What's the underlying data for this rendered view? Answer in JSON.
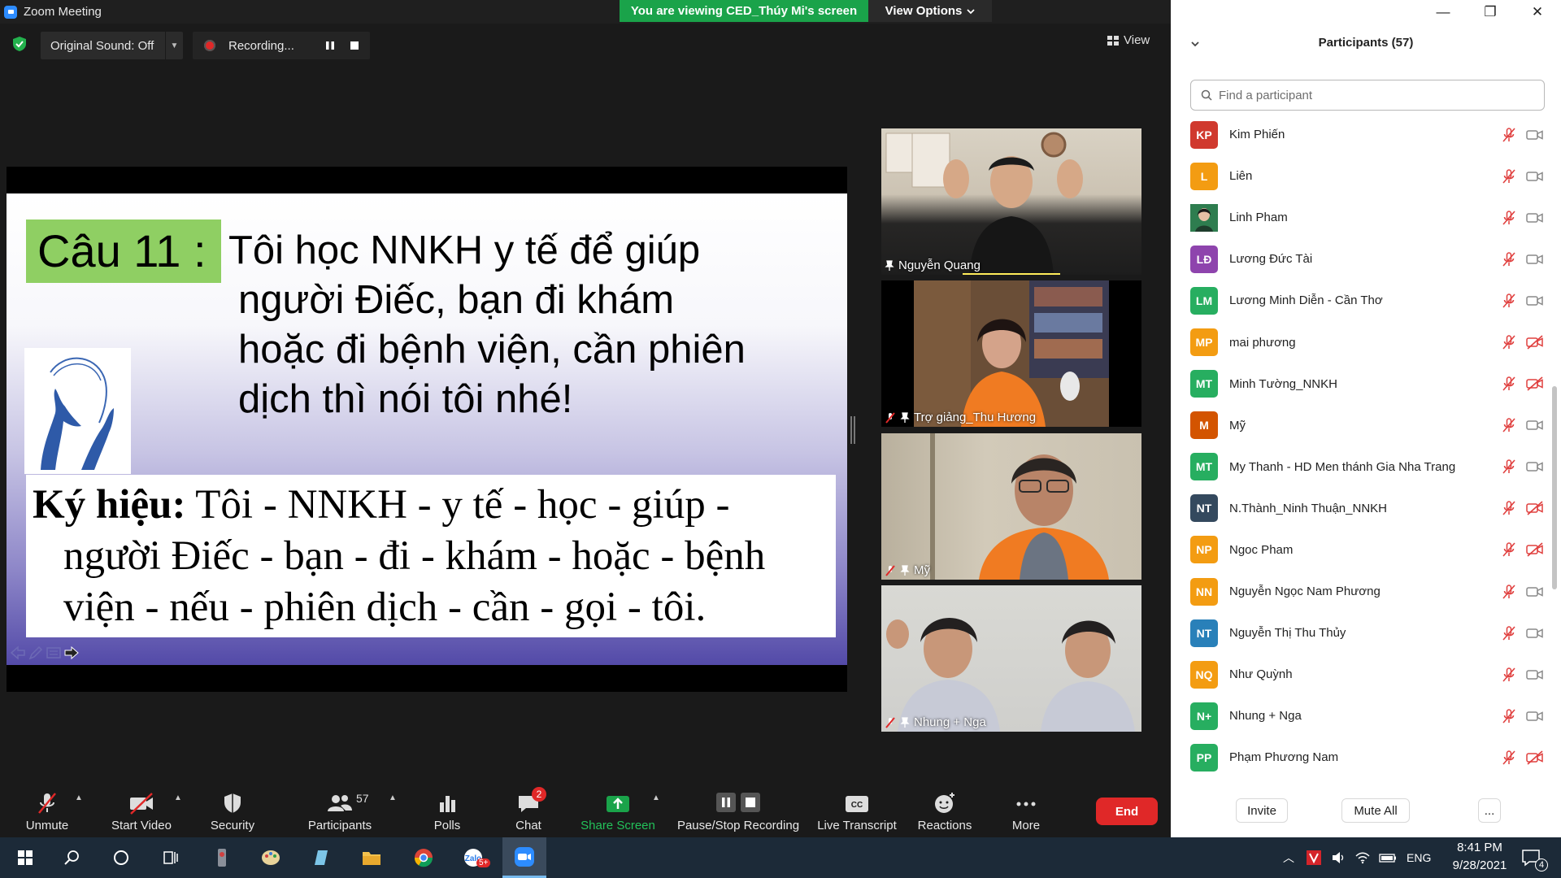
{
  "window": {
    "title": "Zoom Meeting",
    "viewing_banner": "You are viewing CED_Thúy Mi's screen",
    "view_options": "View Options",
    "minimize": "—",
    "maximize": "❐",
    "close": "✕"
  },
  "top_toolbar": {
    "sound_label": "Original Sound: Off",
    "recording_label": "Recording...",
    "view_label": "View"
  },
  "slide": {
    "question_label": "Câu 11 :",
    "question_lines": [
      "Tôi học NNKH y tế để giúp",
      "người Điếc, bạn đi khám",
      "hoặc đi bệnh viện, cần phiên",
      "dịch thì nói tôi nhé!"
    ],
    "sign_label": "Ký hiệu:",
    "sign_lines": [
      "Tôi - NNKH - y tế - học - giúp -",
      "người Điếc - bạn - đi - khám - hoặc - bệnh",
      "viện - nếu - phiên dịch - cần - gọi - tôi."
    ]
  },
  "videos": [
    {
      "name": "Nguyễn Quang",
      "muted": false
    },
    {
      "name": "Trợ giảng_Thu Hương",
      "muted": true
    },
    {
      "name": "Mỹ",
      "muted": true
    },
    {
      "name": "Nhung + Nga",
      "muted": true
    }
  ],
  "participants_panel": {
    "title": "Participants (57)",
    "search_placeholder": "Find a participant",
    "items": [
      {
        "initials": "KP",
        "name": "Kim Phiến",
        "color": "#d0392e",
        "video_off": false
      },
      {
        "initials": "L",
        "name": "Liên",
        "color": "#f39c12",
        "video_off": false
      },
      {
        "initials": "",
        "name": "Linh Pham",
        "color": "#2e7d4f",
        "video_off": false,
        "photo": true
      },
      {
        "initials": "LĐ",
        "name": "Lương Đức Tài",
        "color": "#8e44ad",
        "video_off": false
      },
      {
        "initials": "LM",
        "name": "Lương Minh Diễn - Cần Thơ",
        "color": "#27ae60",
        "video_off": false
      },
      {
        "initials": "MP",
        "name": "mai phương",
        "color": "#f39c12",
        "video_off": true
      },
      {
        "initials": "MT",
        "name": "Minh Tường_NNKH",
        "color": "#27ae60",
        "video_off": true
      },
      {
        "initials": "M",
        "name": "Mỹ",
        "color": "#d35400",
        "video_off": false
      },
      {
        "initials": "MT",
        "name": "My Thanh - HD Men thánh Gia Nha Trang",
        "color": "#27ae60",
        "video_off": false
      },
      {
        "initials": "NT",
        "name": "N.Thành_Ninh Thuận_NNKH",
        "color": "#34495e",
        "video_off": true
      },
      {
        "initials": "NP",
        "name": "Ngoc Pham",
        "color": "#f39c12",
        "video_off": true
      },
      {
        "initials": "NN",
        "name": "Nguyễn Ngọc Nam Phương",
        "color": "#f39c12",
        "video_off": false
      },
      {
        "initials": "NT",
        "name": "Nguyễn Thị Thu Thủy",
        "color": "#2980b9",
        "video_off": false
      },
      {
        "initials": "NQ",
        "name": "Như Quỳnh",
        "color": "#f39c12",
        "video_off": false
      },
      {
        "initials": "N+",
        "name": "Nhung + Nga",
        "color": "#27ae60",
        "video_off": false
      },
      {
        "initials": "PP",
        "name": "Phạm Phương Nam",
        "color": "#27ae60",
        "video_off": true
      }
    ],
    "invite_label": "Invite",
    "mute_all_label": "Mute All",
    "more_label": "..."
  },
  "bottom_toolbar": {
    "unmute": "Unmute",
    "start_video": "Start Video",
    "security": "Security",
    "participants": "Participants",
    "participants_count": "57",
    "polls": "Polls",
    "chat": "Chat",
    "chat_badge": "2",
    "share_screen": "Share Screen",
    "pause_stop": "Pause/Stop Recording",
    "live_transcript": "Live Transcript",
    "reactions": "Reactions",
    "more": "More",
    "end": "End"
  },
  "taskbar": {
    "language": "ENG",
    "time": "8:41 PM",
    "date": "9/28/2021",
    "notification_count": "4",
    "zalo_badge": "5+"
  },
  "colors": {
    "green_banner": "#1aa34a",
    "end_red": "#e02828",
    "share_green": "#1aa34a"
  }
}
